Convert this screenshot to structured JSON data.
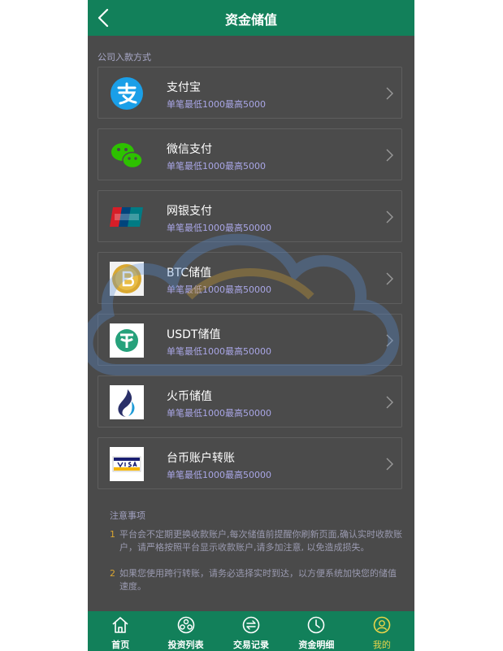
{
  "header": {
    "title": "资金储值",
    "back_icon": "chevron-left-icon"
  },
  "section_label": "公司入款方式",
  "methods": [
    {
      "name": "支付宝",
      "limit": "单笔最低1000最高5000",
      "icon": "alipay-icon"
    },
    {
      "name": "微信支付",
      "limit": "单笔最低1000最高5000",
      "icon": "wechat-icon"
    },
    {
      "name": "网银支付",
      "limit": "单笔最低1000最高50000",
      "icon": "unionpay-icon"
    },
    {
      "name": "BTC储值",
      "limit": "单笔最低1000最高50000",
      "icon": "bitcoin-icon"
    },
    {
      "name": "USDT储值",
      "limit": "单笔最低1000最高50000",
      "icon": "tether-icon"
    },
    {
      "name": "火币储值",
      "limit": "单笔最低1000最高50000",
      "icon": "huobi-icon"
    },
    {
      "name": "台币账户转账",
      "limit": "单笔最低1000最高50000",
      "icon": "visa-icon"
    }
  ],
  "notes": {
    "title": "注意事项",
    "items": [
      {
        "num": "1",
        "text": "平台会不定期更换收款账户,每次储值前提醒你刷新页面,确认实时收款账户，请严格按照平台显示收款账户,请多加注意, 以免造成损失。"
      },
      {
        "num": "2",
        "text": "如果您使用跨行转账，请务必选择实时到达，以方便系统加快您的储值速度。"
      }
    ]
  },
  "tabs": [
    {
      "label": "首页",
      "icon": "home-icon",
      "active": false
    },
    {
      "label": "投资列表",
      "icon": "ball-icon",
      "active": false
    },
    {
      "label": "交易记录",
      "icon": "exchange-icon",
      "active": false
    },
    {
      "label": "资金明细",
      "icon": "clock-icon",
      "active": false
    },
    {
      "label": "我的",
      "icon": "user-icon",
      "active": true
    }
  ],
  "colors": {
    "brand": "#12805a",
    "background": "#4a4a4a",
    "limit_text": "#a9a6e6",
    "active_tab": "#e8d44a"
  }
}
